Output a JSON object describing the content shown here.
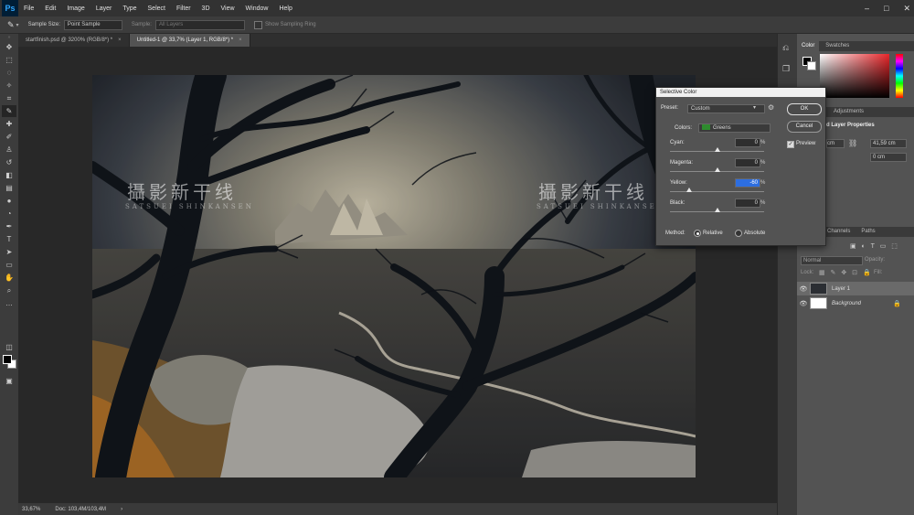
{
  "menubar": {
    "logo": "Ps",
    "items": [
      "File",
      "Edit",
      "Image",
      "Layer",
      "Type",
      "Select",
      "Filter",
      "3D",
      "View",
      "Window",
      "Help"
    ],
    "window_controls": [
      "–",
      "□",
      "✕"
    ]
  },
  "options": {
    "sample_size_label": "Sample Size:",
    "sample_size_value": "Point Sample",
    "sample_label": "Sample:",
    "sample_value": "All Layers",
    "show_ring_label": "Show Sampling Ring"
  },
  "tabs": [
    {
      "label": "startfinish.psd @ 3200% (RGB/8*) *",
      "close": "×"
    },
    {
      "label": "Untitled-1 @ 33,7% (Layer 1, RGB/8*) *",
      "close": "×"
    }
  ],
  "watermark": {
    "left_cn": "攝影新干线",
    "left_en": "SATSUEI SHINKANSEN",
    "right_cn": "攝影新干线",
    "right_en": "SATSUEI SHINKANSEN"
  },
  "status": {
    "zoom": "33,67%",
    "doc": "Doc: 103,4M/103,4M",
    "arrow": "›"
  },
  "dialog": {
    "title": "Selective Color",
    "preset_label": "Preset:",
    "preset_value": "Custom",
    "colors_label": "Colors:",
    "colors_value": "Greens",
    "colors_swatch": "#2e8b2e",
    "sliders": [
      {
        "label": "Cyan:",
        "value": "0",
        "level": 0
      },
      {
        "label": "Magenta:",
        "value": "0",
        "level": 0
      },
      {
        "label": "Yellow:",
        "value": "-60",
        "level": -60
      },
      {
        "label": "Black:",
        "value": "0",
        "level": 0
      }
    ],
    "pct": "%",
    "method_label": "Method:",
    "relative_label": "Relative",
    "absolute_label": "Absolute",
    "ok_label": "OK",
    "cancel_label": "Cancel",
    "preview_label": "Preview"
  },
  "right": {
    "color_tabs": [
      "Color",
      "Swatches"
    ],
    "props_tabs": [
      "Adjustments"
    ],
    "props_title": "d Layer Properties",
    "props_w": "cm",
    "props_h": "41,59 cm",
    "props_y": "0 cm",
    "layer_tabs": [
      "Channels",
      "Paths"
    ],
    "blend_mode": "Normal",
    "opacity_label": "Opacity:",
    "lock_label": "Lock:",
    "fill_label": "Fill:",
    "layers": [
      {
        "name": "Layer 1",
        "selected": true
      },
      {
        "name": "Background",
        "selected": false
      }
    ]
  }
}
